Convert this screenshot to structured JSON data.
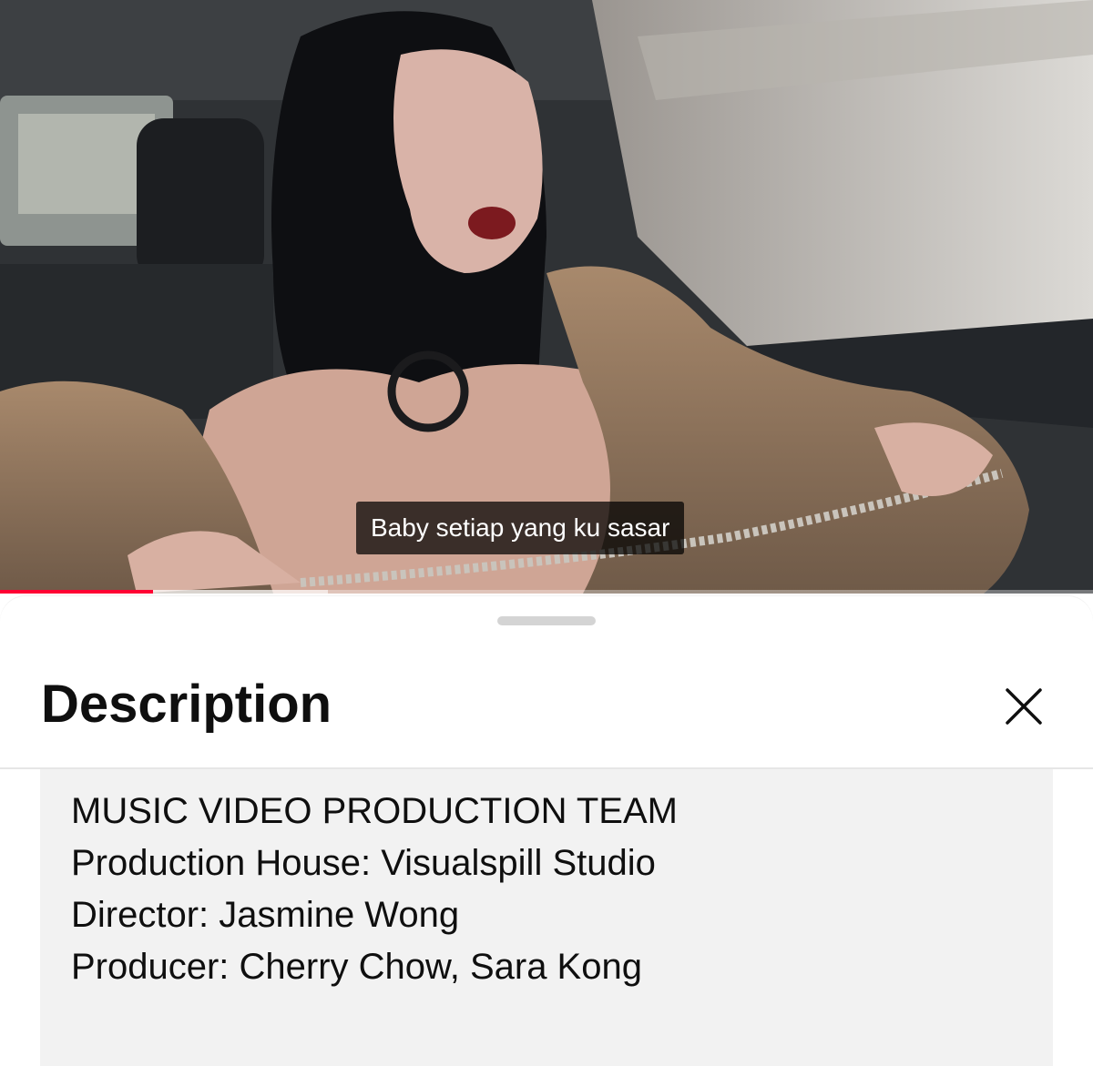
{
  "video": {
    "subtitle": "Baby setiap yang ku sasar",
    "progress_fraction": 0.14,
    "buffered_fraction": 0.3,
    "progress_color": "#ff0033"
  },
  "sheet": {
    "title": "Description",
    "close_icon": "close-icon",
    "description_lines": [
      "MUSIC VIDEO PRODUCTION TEAM",
      "Production House: Visualspill Studio",
      "Director: Jasmine Wong",
      "Producer: Cherry Chow, Sara Kong"
    ]
  }
}
